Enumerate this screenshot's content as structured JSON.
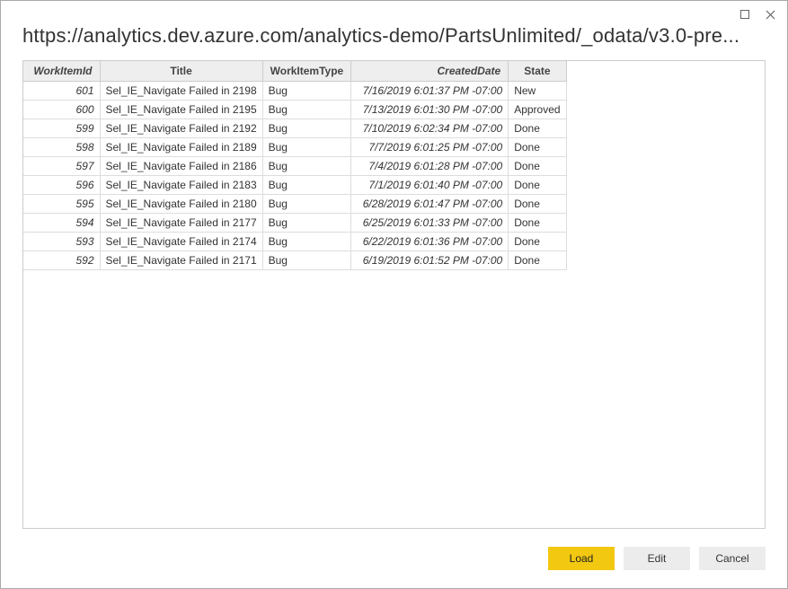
{
  "window": {
    "url": "https://analytics.dev.azure.com/analytics-demo/PartsUnlimited/_odata/v3.0-pre..."
  },
  "table": {
    "headers": [
      "WorkItemId",
      "Title",
      "WorkItemType",
      "CreatedDate",
      "State"
    ],
    "rows": [
      {
        "id": "601",
        "title": "Sel_IE_Navigate Failed in 2198",
        "type": "Bug",
        "date": "7/16/2019 6:01:37 PM -07:00",
        "state": "New"
      },
      {
        "id": "600",
        "title": "Sel_IE_Navigate Failed in 2195",
        "type": "Bug",
        "date": "7/13/2019 6:01:30 PM -07:00",
        "state": "Approved"
      },
      {
        "id": "599",
        "title": "Sel_IE_Navigate Failed in 2192",
        "type": "Bug",
        "date": "7/10/2019 6:02:34 PM -07:00",
        "state": "Done"
      },
      {
        "id": "598",
        "title": "Sel_IE_Navigate Failed in 2189",
        "type": "Bug",
        "date": "7/7/2019 6:01:25 PM -07:00",
        "state": "Done"
      },
      {
        "id": "597",
        "title": "Sel_IE_Navigate Failed in 2186",
        "type": "Bug",
        "date": "7/4/2019 6:01:28 PM -07:00",
        "state": "Done"
      },
      {
        "id": "596",
        "title": "Sel_IE_Navigate Failed in 2183",
        "type": "Bug",
        "date": "7/1/2019 6:01:40 PM -07:00",
        "state": "Done"
      },
      {
        "id": "595",
        "title": "Sel_IE_Navigate Failed in 2180",
        "type": "Bug",
        "date": "6/28/2019 6:01:47 PM -07:00",
        "state": "Done"
      },
      {
        "id": "594",
        "title": "Sel_IE_Navigate Failed in 2177",
        "type": "Bug",
        "date": "6/25/2019 6:01:33 PM -07:00",
        "state": "Done"
      },
      {
        "id": "593",
        "title": "Sel_IE_Navigate Failed in 2174",
        "type": "Bug",
        "date": "6/22/2019 6:01:36 PM -07:00",
        "state": "Done"
      },
      {
        "id": "592",
        "title": "Sel_IE_Navigate Failed in 2171",
        "type": "Bug",
        "date": "6/19/2019 6:01:52 PM -07:00",
        "state": "Done"
      }
    ]
  },
  "buttons": {
    "load": "Load",
    "edit": "Edit",
    "cancel": "Cancel"
  }
}
